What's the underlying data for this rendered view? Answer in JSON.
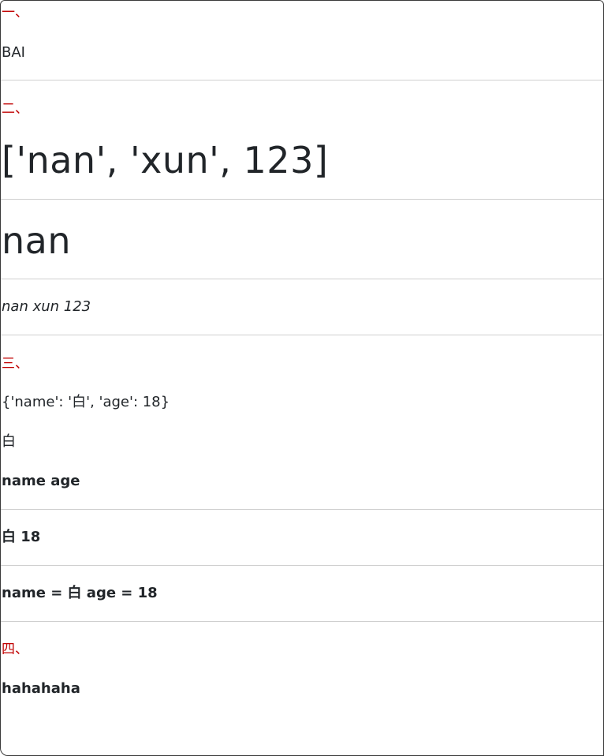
{
  "section1": {
    "heading": "一、",
    "value": "BAI"
  },
  "section2": {
    "heading": "二、",
    "list_repr": "['nan', 'xun', 123]",
    "first_item": "nan",
    "items_joined": "nan xun 123"
  },
  "section3": {
    "heading": "三、",
    "dict_repr": "{'name': '白', 'age': 18}",
    "name_value": "白",
    "keys": "name age",
    "values": "白 18",
    "pairs": "name = 白 age = 18"
  },
  "section4": {
    "heading": "四、",
    "text": "hahahaha"
  },
  "colors": {
    "heading_red": "#c00000",
    "text": "#212529",
    "divider": "#cfcfcf"
  }
}
